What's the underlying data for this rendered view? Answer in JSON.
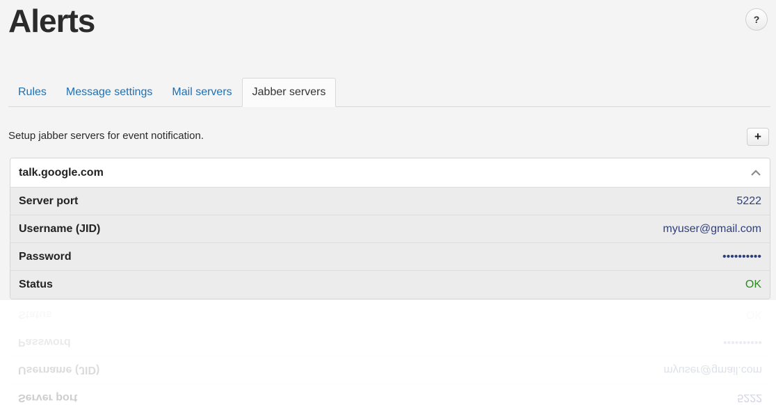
{
  "page": {
    "title": "Alerts",
    "help_label": "?"
  },
  "tabs": [
    {
      "label": "Rules",
      "active": false
    },
    {
      "label": "Message settings",
      "active": false
    },
    {
      "label": "Mail servers",
      "active": false
    },
    {
      "label": "Jabber servers",
      "active": true
    }
  ],
  "section": {
    "description": "Setup jabber servers for event notification.",
    "add_label": "+"
  },
  "server": {
    "name": "talk.google.com",
    "rows": [
      {
        "key": "Server port",
        "value": "5222"
      },
      {
        "key": "Username (JID)",
        "value": "myuser@gmail.com"
      },
      {
        "key": "Password",
        "value": "••••••••••"
      },
      {
        "key": "Status",
        "value": "OK"
      }
    ]
  },
  "colors": {
    "link": "#1f6fb2",
    "value": "#2f3f7a",
    "status_ok": "#2a8a1e"
  },
  "icons": {
    "expand_toggle": "chevron-up-icon"
  }
}
